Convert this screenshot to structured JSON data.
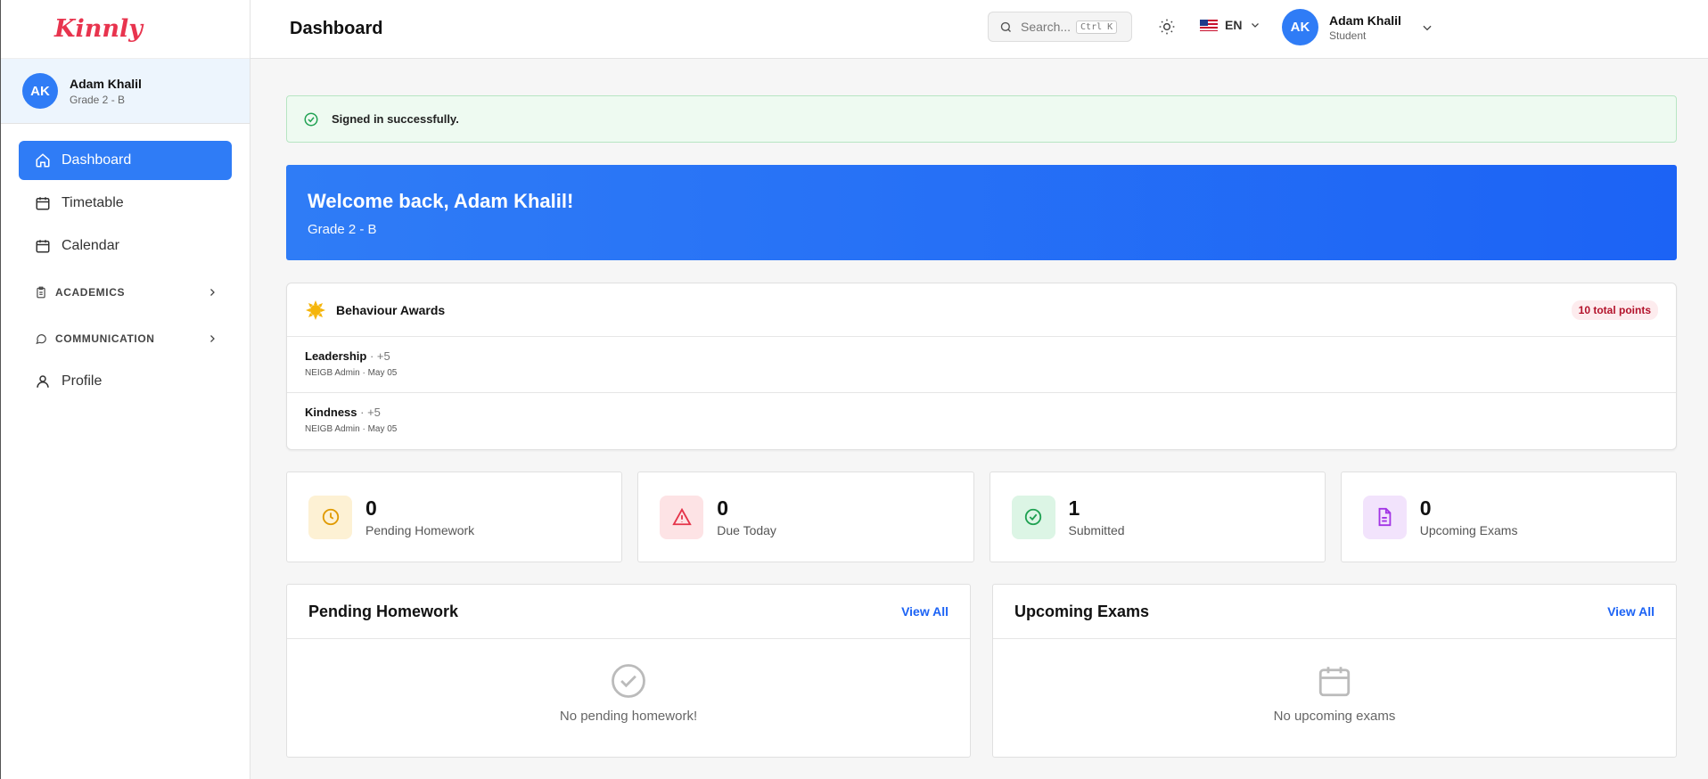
{
  "app": {
    "logo": "Kinnly"
  },
  "sidebar": {
    "user": {
      "initials": "AK",
      "name": "Adam Khalil",
      "sub": "Grade 2 - B"
    },
    "items": [
      {
        "label": "Dashboard",
        "icon": "home-icon"
      },
      {
        "label": "Timetable",
        "icon": "calendar-icon"
      },
      {
        "label": "Calendar",
        "icon": "calendar-icon"
      }
    ],
    "groups": [
      {
        "label": "ACADEMICS",
        "icon": "clipboard-icon"
      },
      {
        "label": "COMMUNICATION",
        "icon": "chat-icon"
      }
    ],
    "profile": {
      "label": "Profile",
      "icon": "user-icon"
    }
  },
  "header": {
    "title": "Dashboard",
    "search": {
      "placeholder": "Search...",
      "shortcut": "Ctrl K"
    },
    "language": "EN",
    "user": {
      "initials": "AK",
      "name": "Adam Khalil",
      "role": "Student"
    }
  },
  "alert": {
    "text": "Signed in successfully."
  },
  "welcome": {
    "title": "Welcome back, Adam Khalil!",
    "subtitle": "Grade 2 - B"
  },
  "awards": {
    "title": "Behaviour Awards",
    "total": "10 total points",
    "items": [
      {
        "name": "Leadership",
        "points": "· +5",
        "meta": "NEIGB Admin · May 05"
      },
      {
        "name": "Kindness",
        "points": "· +5",
        "meta": "NEIGB Admin · May 05"
      }
    ]
  },
  "stats": [
    {
      "value": "0",
      "label": "Pending Homework",
      "color": "#f0a500",
      "bg": "#fdf1d4"
    },
    {
      "value": "0",
      "label": "Due Today",
      "color": "#e5344a",
      "bg": "#fde3e5"
    },
    {
      "value": "1",
      "label": "Submitted",
      "color": "#1fa152",
      "bg": "#dcf5e5"
    },
    {
      "value": "0",
      "label": "Upcoming Exams",
      "color": "#a234e5",
      "bg": "#f2e3fc"
    }
  ],
  "panels": {
    "homework": {
      "title": "Pending Homework",
      "link": "View All",
      "empty": "No pending homework!"
    },
    "exams": {
      "title": "Upcoming Exams",
      "link": "View All",
      "empty": "No upcoming exams"
    }
  },
  "colors": {
    "primary": "#2f7cf6",
    "brand": "#e8344e",
    "success": "#1fa152"
  }
}
